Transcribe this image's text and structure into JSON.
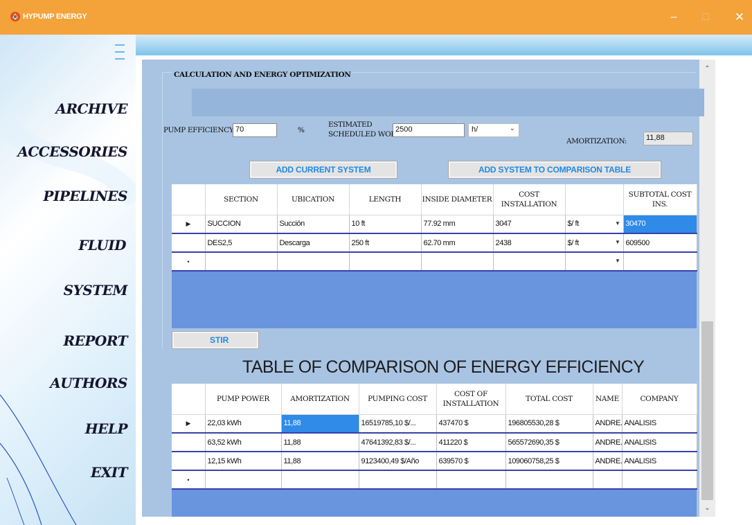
{
  "window": {
    "title": "HYPUMP ENERGY",
    "min": "–",
    "max": "□",
    "close": "✕"
  },
  "sidebar": {
    "items": [
      "ARCHIVE",
      "ACCESSORIES",
      "PIPELINES",
      "FLUID",
      "SYSTEM",
      "REPORT",
      "AUTHORS",
      "HELP",
      "EXIT"
    ]
  },
  "panel": {
    "group_title": "CALCULATION AND ENERGY OPTIMIZATION",
    "pump_eff_label": "PUMP EFFICIENCY:",
    "pump_eff_value": "70",
    "pump_eff_unit": "%",
    "sched_label_1": "ESTIMATED",
    "sched_label_2": "SCHEDULED WORK:",
    "sched_value": "2500",
    "sched_unit": "h/",
    "amort_label": "AMORTIZATION:",
    "amort_value": "11,88",
    "add_current": "ADD CURRENT SYSTEM",
    "add_comparison": "ADD SYSTEM TO COMPARISON TABLE",
    "stir": "STIR",
    "comparison_title": "TABLE OF COMPARISON OF ENERGY EFFICIENCY"
  },
  "sections_table": {
    "headers": [
      "SECTION",
      "UBICATION",
      "LENGTH",
      "INSIDE DIAMETER",
      "COST INSTALLATION",
      "",
      "SUBTOTAL COST INS."
    ],
    "rows": [
      {
        "marker": "▶",
        "section": "SUCCION",
        "ubication": "Succión",
        "length": "10 ft",
        "diameter": "77.92 mm",
        "cost": "3047",
        "unit": "$/ ft",
        "subtotal": "30470"
      },
      {
        "marker": "",
        "section": "DES2,5",
        "ubication": "Descarga",
        "length": "250 ft",
        "diameter": "62.70 mm",
        "cost": "2438",
        "unit": "$/ ft",
        "subtotal": "609500"
      },
      {
        "marker": "•",
        "section": "",
        "ubication": "",
        "length": "",
        "diameter": "",
        "cost": "",
        "unit": "",
        "subtotal": ""
      }
    ]
  },
  "comparison_table": {
    "headers": [
      "PUMP POWER",
      "AMORTIZATION",
      "PUMPING COST",
      "COST OF INSTALLATION",
      "TOTAL COST",
      "NAME",
      "COMPANY"
    ],
    "rows": [
      {
        "marker": "▶",
        "power": "22,03 kWh",
        "amort": "11,88",
        "pumping": "16519785,10 $/...",
        "install": "437470 $",
        "total": "196805530,28 $",
        "name": "ANDRE...",
        "company": "ANALISIS"
      },
      {
        "marker": "",
        "power": "63,52 kWh",
        "amort": "11,88",
        "pumping": "47641392,83 $/...",
        "install": "411220 $",
        "total": "565572690,35 $",
        "name": "ANDRE...",
        "company": "ANALISIS"
      },
      {
        "marker": "",
        "power": "12,15 kWh",
        "amort": "11,88",
        "pumping": "9123400,49 $/Año",
        "install": "639570 $",
        "total": "109060758,25 $",
        "name": "ANDRE...",
        "company": "ANALISIS"
      },
      {
        "marker": "•",
        "power": "",
        "amort": "",
        "pumping": "",
        "install": "",
        "total": "",
        "name": "",
        "company": ""
      }
    ]
  }
}
